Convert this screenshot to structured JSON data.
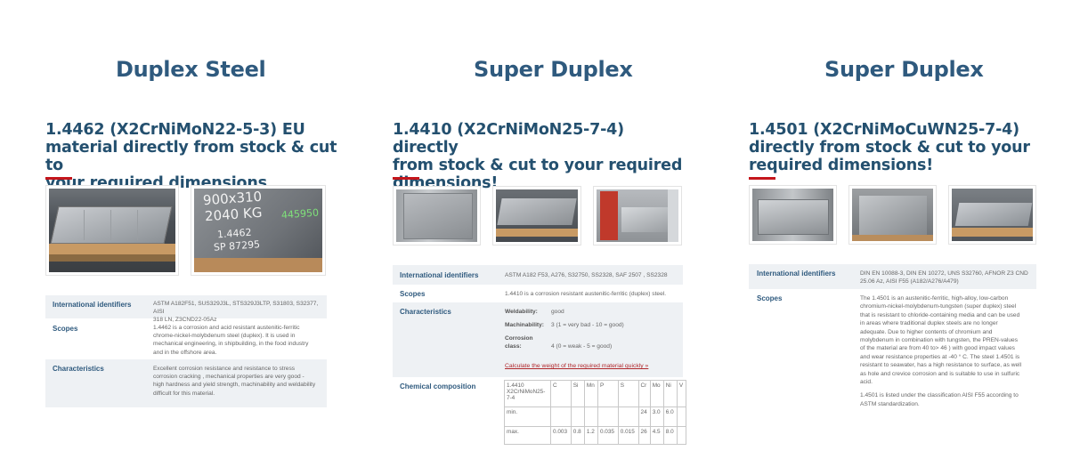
{
  "columns": [
    {
      "title": "Duplex Steel",
      "headline": [
        "1.4462 (X2CrNiMoN22-5-3) EU",
        "material directly from stock & cut to",
        "your required dimensions"
      ],
      "stamp_text": [
        "900x310",
        "2040 KG",
        "445950",
        "1.4462",
        "SP 87295"
      ],
      "rows": [
        {
          "label": "International identifiers",
          "lines": [
            "ASTM A182F51, SUS329J3L, STS329J3LTP, S31803, S32377, AISI",
            "318 LN, Z3CND22-05Az"
          ]
        },
        {
          "label": "Scopes",
          "lines": [
            "1.4462 is a corrosion and acid resistant austenitic-ferritic",
            "chrome-nickel-molybdenum steel (duplex). It is used in",
            "mechanical engineering, in shipbuilding, in the food industry",
            "and in the offshore area."
          ]
        },
        {
          "label": "Characteristics",
          "lines": [
            "Excellent corrosion resistance and resistance to stress",
            "corrosion cracking , mechanical properties are very good -",
            "high hardness and yield strength, machinability and weldability",
            "difficult for this material."
          ]
        }
      ]
    },
    {
      "title": "Super Duplex",
      "headline": [
        "1.4410 (X2CrNiMoN25-7-4) directly",
        "from stock & cut to your required",
        "dimensions!"
      ],
      "rows": [
        {
          "label": "International identifiers",
          "lines": [
            "ASTM A182 F53, A276, S32750, SS2328, SAF 2507 , SS2328"
          ]
        },
        {
          "label": "Scopes",
          "lines": [
            "1.4410 is a corrosion resistant austenitic-ferritic (duplex) steel."
          ]
        },
        {
          "label": "Characteristics",
          "props": [
            {
              "key": "Weldability:",
              "value": "good"
            },
            {
              "key": "Machinability:",
              "value": "3 (1 = very bad - 10 = good)"
            },
            {
              "key": "Corrosion class:",
              "value": "4 (0 = weak - 5 = good)"
            }
          ],
          "link": "Calculate the weight of the required material quickly »"
        },
        {
          "label": "Chemical composition"
        }
      ],
      "chem": {
        "header": [
          "1.4410\nX2CrNiMoN25-\n7-4",
          "C",
          "Si",
          "Mn",
          "P",
          "S",
          "Cr",
          "Mo",
          "Ni",
          "V"
        ],
        "rows": [
          [
            "min.",
            "",
            "",
            "",
            "",
            "",
            "24",
            "3.0",
            "6.0",
            ""
          ],
          [
            "max.",
            "0.003",
            "0.8",
            "1.2",
            "0.035",
            "0.015",
            "26",
            "4.5",
            "8.0",
            ""
          ]
        ]
      }
    },
    {
      "title": "Super Duplex",
      "headline": [
        "1.4501 (X2CrNiMoCuWN25-7-4)",
        "directly from stock & cut to your",
        "required dimensions!"
      ],
      "rows": [
        {
          "label": "International identifiers",
          "lines": [
            "DIN EN 10088-3, DIN EN 10272, UNS S32760, AFNOR Z3 CND",
            "25.06 Az, AISI F55 (A182/A276/A479)"
          ]
        },
        {
          "label": "Scopes",
          "lines": [
            "The 1.4501 is an austenitic-ferritic, high-alloy, low-carbon",
            "chromium-nickel-molybdenum-tungsten (super duplex) steel",
            "that is resistant to chloride-containing media and can be used",
            "in areas where traditional duplex steels are no longer",
            "adequate. Due to higher contents of chromium and",
            "molybdenum in combination with tungsten, the PREN-values",
            "of the material are from 40 to> 46 ) with good impact values",
            "and wear resistance properties at -40 ° C. The steel 1.4501 is",
            "resistant to seawater, has a high resistance to surface, as well",
            "as hole and crevice corrosion and is suitable to use in sulfuric",
            "acid."
          ],
          "extra": [
            "1.4501 is listed under the classification AISI F55 according to",
            "ASTM standardization."
          ]
        }
      ]
    }
  ],
  "colors": {
    "title": "#2f5a7e",
    "accent": "#c4161c",
    "shade": "#eef1f4"
  }
}
